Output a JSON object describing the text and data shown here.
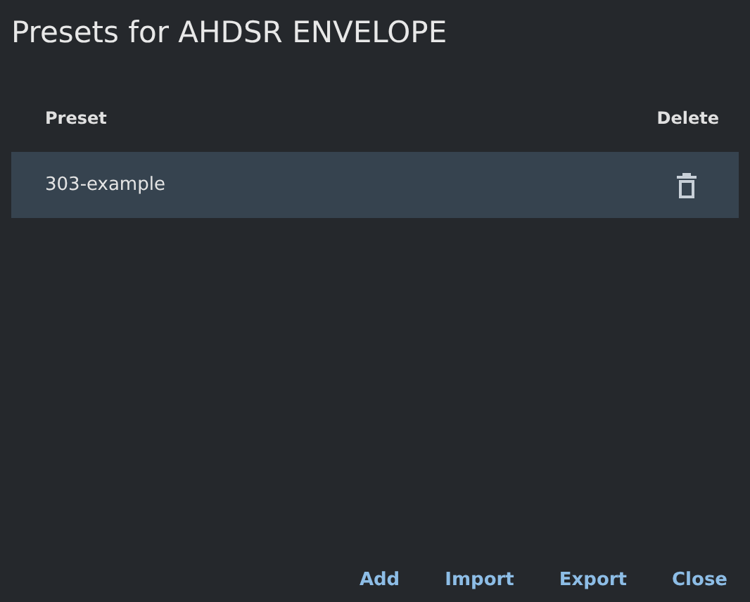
{
  "title": "Presets for AHDSR ENVELOPE",
  "table": {
    "columns": [
      "Preset",
      "Delete"
    ],
    "rows": [
      {
        "name": "303-example",
        "selected": true
      }
    ]
  },
  "buttons": [
    "Add",
    "Import",
    "Export",
    "Close"
  ]
}
